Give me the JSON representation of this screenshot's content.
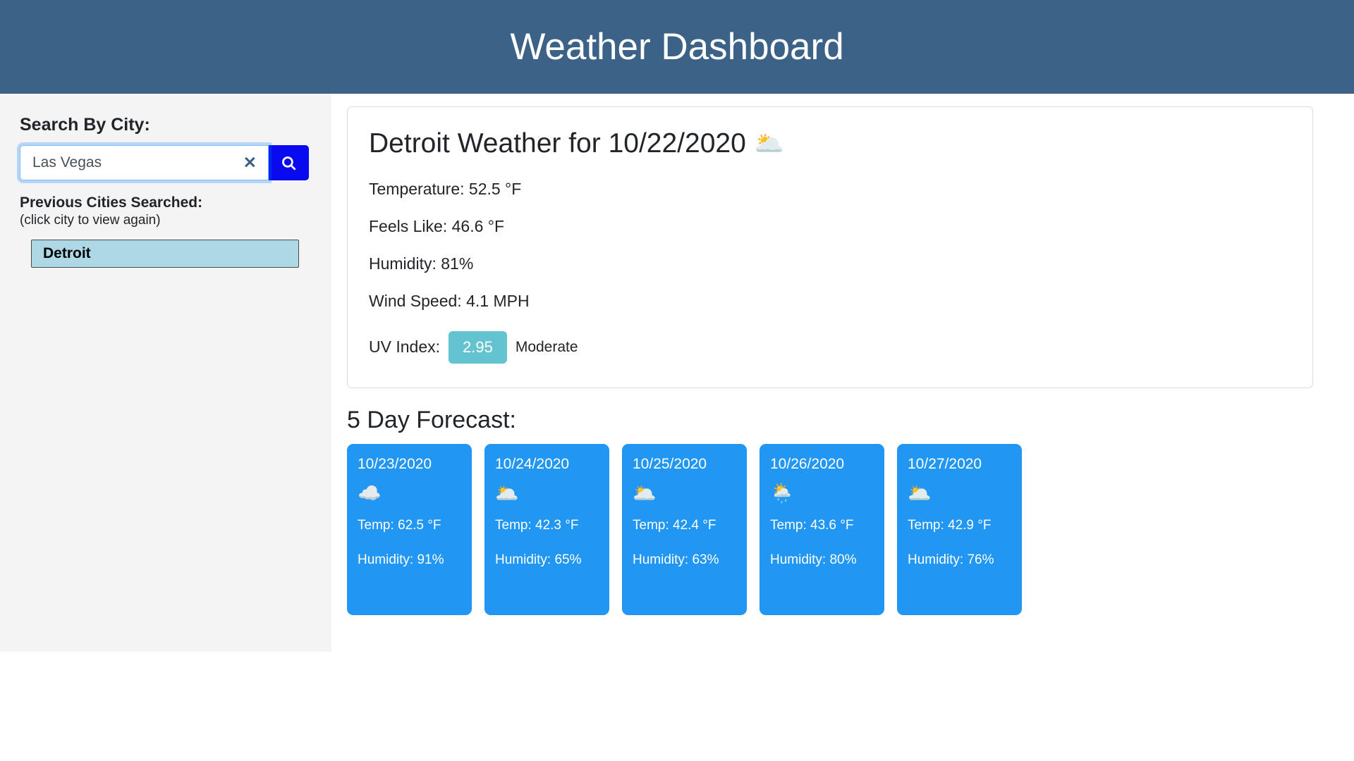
{
  "header": {
    "title": "Weather Dashboard",
    "background_color": "#3c6287"
  },
  "sidebar": {
    "search_heading": "Search By City:",
    "search_input": {
      "value": "Las Vegas",
      "placeholder": "Search By City",
      "clear_icon": "close-icon",
      "clear_label": "✕"
    },
    "search_button": {
      "icon": "search-icon",
      "background_color": "#0a0af0"
    },
    "previous_label": "Previous Cities Searched:",
    "previous_sublabel": "(click city to view again)",
    "cities": [
      {
        "name": "Detroit"
      }
    ]
  },
  "current": {
    "title": "Detroit Weather for 10/22/2020",
    "city": "Detroit",
    "date": "10/22/2020",
    "condition_icon": "broken-clouds-icon",
    "condition_emoji": "🌥️",
    "stats": [
      {
        "label": "Temperature:",
        "value": "52.5 °F",
        "text": "Temperature: 52.5 °F"
      },
      {
        "label": "Feels Like:",
        "value": "46.6 °F",
        "text": "Feels Like: 46.6 °F"
      },
      {
        "label": "Humidity:",
        "value": "81%",
        "text": "Humidity: 81%"
      },
      {
        "label": "Wind Speed:",
        "value": "4.1 MPH",
        "text": "Wind Speed: 4.1 MPH"
      }
    ],
    "uv": {
      "label": "UV Index:",
      "value": "2.95",
      "description": "Moderate",
      "badge_color": "#63c3ce"
    }
  },
  "forecast": {
    "heading": "5 Day Forecast:",
    "card_color": "#2196f3",
    "days": [
      {
        "date": "10/23/2020",
        "icon": "cloud-icon",
        "emoji": "☁️",
        "temp": "Temp: 62.5 °F",
        "humidity": "Humidity: 91%",
        "temp_value": 62.5,
        "humidity_value": 91
      },
      {
        "date": "10/24/2020",
        "icon": "broken-clouds-icon",
        "emoji": "🌥️",
        "temp": "Temp: 42.3 °F",
        "humidity": "Humidity: 65%",
        "temp_value": 42.3,
        "humidity_value": 65
      },
      {
        "date": "10/25/2020",
        "icon": "broken-clouds-icon",
        "emoji": "🌥️",
        "temp": "Temp: 42.4 °F",
        "humidity": "Humidity: 63%",
        "temp_value": 42.4,
        "humidity_value": 63
      },
      {
        "date": "10/26/2020",
        "icon": "sun-behind-rain-cloud-icon",
        "emoji": "🌦️",
        "temp": "Temp: 43.6 °F",
        "humidity": "Humidity: 80%",
        "temp_value": 43.6,
        "humidity_value": 80
      },
      {
        "date": "10/27/2020",
        "icon": "broken-clouds-icon",
        "emoji": "🌥️",
        "temp": "Temp: 42.9 °F",
        "humidity": "Humidity: 76%",
        "temp_value": 42.9,
        "humidity_value": 76
      }
    ]
  }
}
